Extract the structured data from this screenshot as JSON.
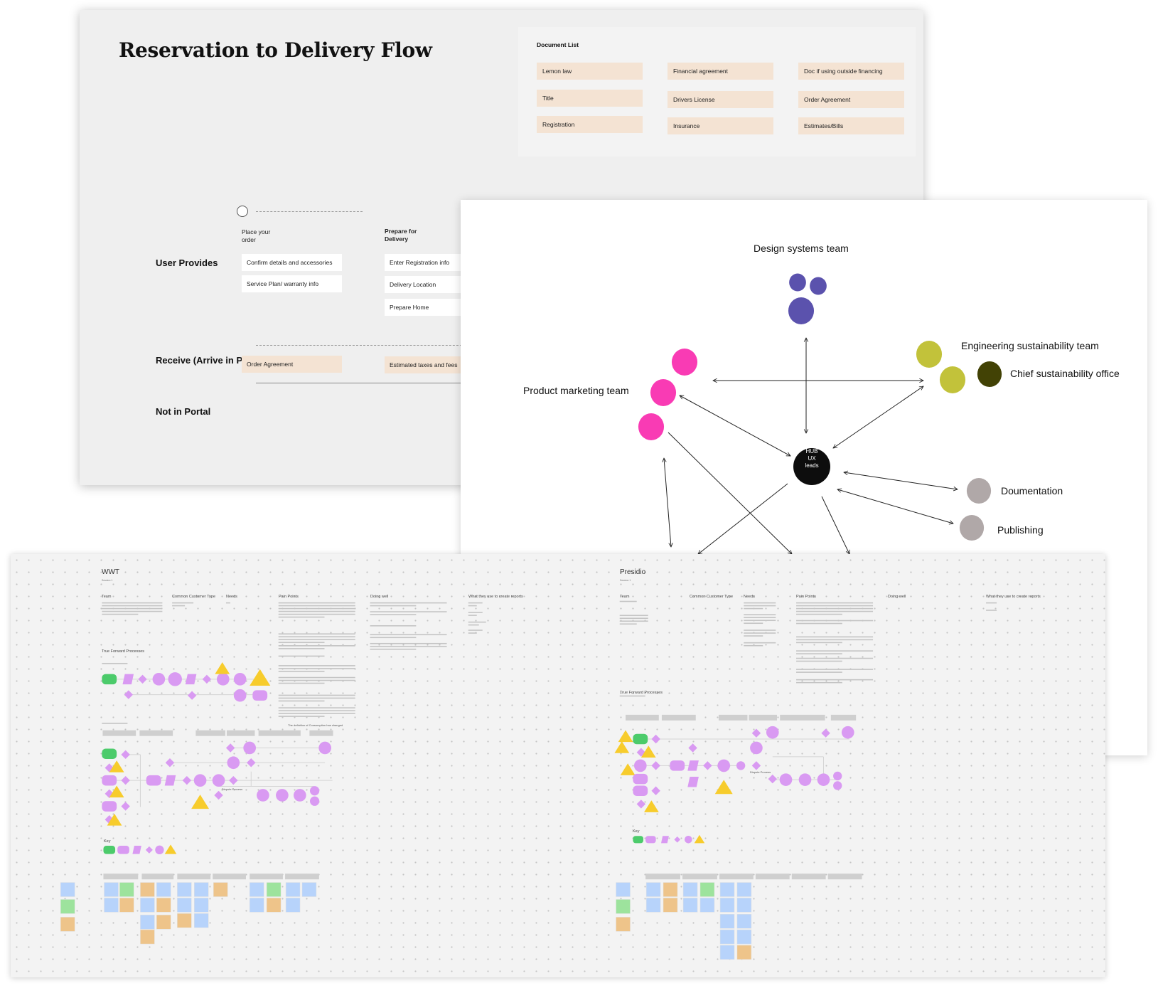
{
  "flow": {
    "title": "Reservation to Delivery Flow",
    "document_list": {
      "title": "Document List",
      "items": [
        "Lemon law",
        "Financial agreement",
        "Doc if using outside financing",
        "Title",
        "Drivers License",
        "Order Agreement",
        "Registration",
        "Insurance",
        "Estimates/Bills"
      ]
    },
    "steps": [
      {
        "label": "Place your order"
      },
      {
        "label": "Prepare for Delivery"
      }
    ],
    "lanes": {
      "user_provides": "User Provides",
      "receive": "Receive (Arrive in Portal)",
      "not_in_portal": "Not in Portal"
    },
    "user_provides_items": {
      "place_order": [
        "Confirm details and accessories",
        "Service Plan/ warranty  info"
      ],
      "prepare_delivery": [
        "Enter Registration info",
        "Delivery Location",
        "Prepare  Home"
      ]
    },
    "receive_items": [
      "Order Agreement",
      "Estimated taxes and fees"
    ]
  },
  "org_chart": {
    "hub": [
      "HUB",
      "UX",
      "leads"
    ],
    "teams": [
      {
        "label": "Design systems team",
        "color": "#5b52ad"
      },
      {
        "label": "Product marketing team",
        "color": "#f93bb4"
      },
      {
        "label": "Engineering sustainability team",
        "color": "#c2c23a"
      },
      {
        "label": "Chief sustainability office",
        "color": "#424205"
      },
      {
        "label": "Doumentation",
        "color": "#b0a8a8"
      },
      {
        "label": "Publishing",
        "color": "#b0a8a8"
      }
    ]
  },
  "board": {
    "sections": [
      {
        "title": "WWT",
        "subtitle": "Session 1",
        "columns": [
          "Team",
          "Common Customer Type",
          "Needs",
          "Pain Points",
          "Doing well",
          "What they use to create reports"
        ],
        "process_title": "True Forward Processes",
        "note": "The definition of Consumption has changed",
        "dispute_label": "Dispute Process",
        "key_label": "Key"
      },
      {
        "title": "Presidio",
        "subtitle": "Session 1",
        "columns": [
          "Team",
          "Common Customer Type",
          "Needs",
          "Pain Points",
          "Doing well",
          "What they use to create reports"
        ],
        "process_title": "True Forward Processes",
        "dispute_label": "Dispute Process",
        "key_label": "Key"
      }
    ],
    "colors": {
      "start": "#4ccb6b",
      "process": "#d99af2",
      "decision": "#f7cc2c",
      "sticky_blue": "#b7d3fb",
      "sticky_green": "#9de39d",
      "sticky_orange": "#eec48a"
    }
  }
}
